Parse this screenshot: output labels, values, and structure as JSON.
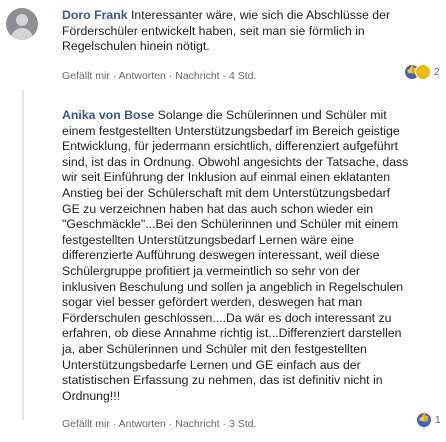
{
  "comments": [
    {
      "author": "Doro Frank",
      "text": "Interessanter wäre, wie sich die Abschlüsse der\nFörderschüler entwickelt haben, seit man sie förmlich in\nRegelschulen hinein nötigt.",
      "actions": {
        "like": "Gefällt mir",
        "reply": "Antworten",
        "message": "Nachricht",
        "time": "4 Std."
      },
      "reaction_count": "2",
      "reaction_icons": [
        "like-icon",
        "haha-icon"
      ]
    },
    {
      "author": "Anika von Bose",
      "text": "Solange die Schülerinnen und Schüler mit\neinem festgestellten Unterstützungsbedarf im Bereich geistige\nEntwicklung, für jedermann ersichtlich, differenziert aufgeführt\nsind, ist das in Ordnung. Obwohl angesichts der Tatsache, dass\nwir seit Einführung der Inklusion auf einmal einen eklatanten\nAnstieg bei der Schülerschaft mit dem Unterstützungsbedarf\nGE zu verzeichnen haben hat das auch schon wieder ein\n\"Geschmäckle\"...Bei den Schülerinnen und Schüler mit einem\nfestgestellten Unterstützungsbedarf Lernen wäre eine\ndifferenzierte Aufführung deswegen interessant, weil diese\nSchülergruppe profitiert ja vermeintlich so sehr von der\ninklusiven Beschulung und sollen ja angeblich in Regelschulen\nsogar viel besser gefördert werden, deswegen hat man\nFörderschulen geschlossen....Da wär es doch interessant zu\nerfahren, ob diese Annahme richtig ist...Differenziert darstellen\nja, aber Schülerinnen und Schüler mit den festgestellten\nUnterstützungsbedarfe Lernen und GE einfach aus der\nstatistischen Erfassung zu nehmen, das ist definitiv nicht in\nOrdnung!!!",
      "actions": {
        "like": "Gefällt mir",
        "reply": "Antworten",
        "message": "Nachricht",
        "time": "3 Std."
      },
      "reaction_count": "1",
      "reaction_icons": [
        "like-icon"
      ]
    }
  ],
  "action_separator": " · "
}
